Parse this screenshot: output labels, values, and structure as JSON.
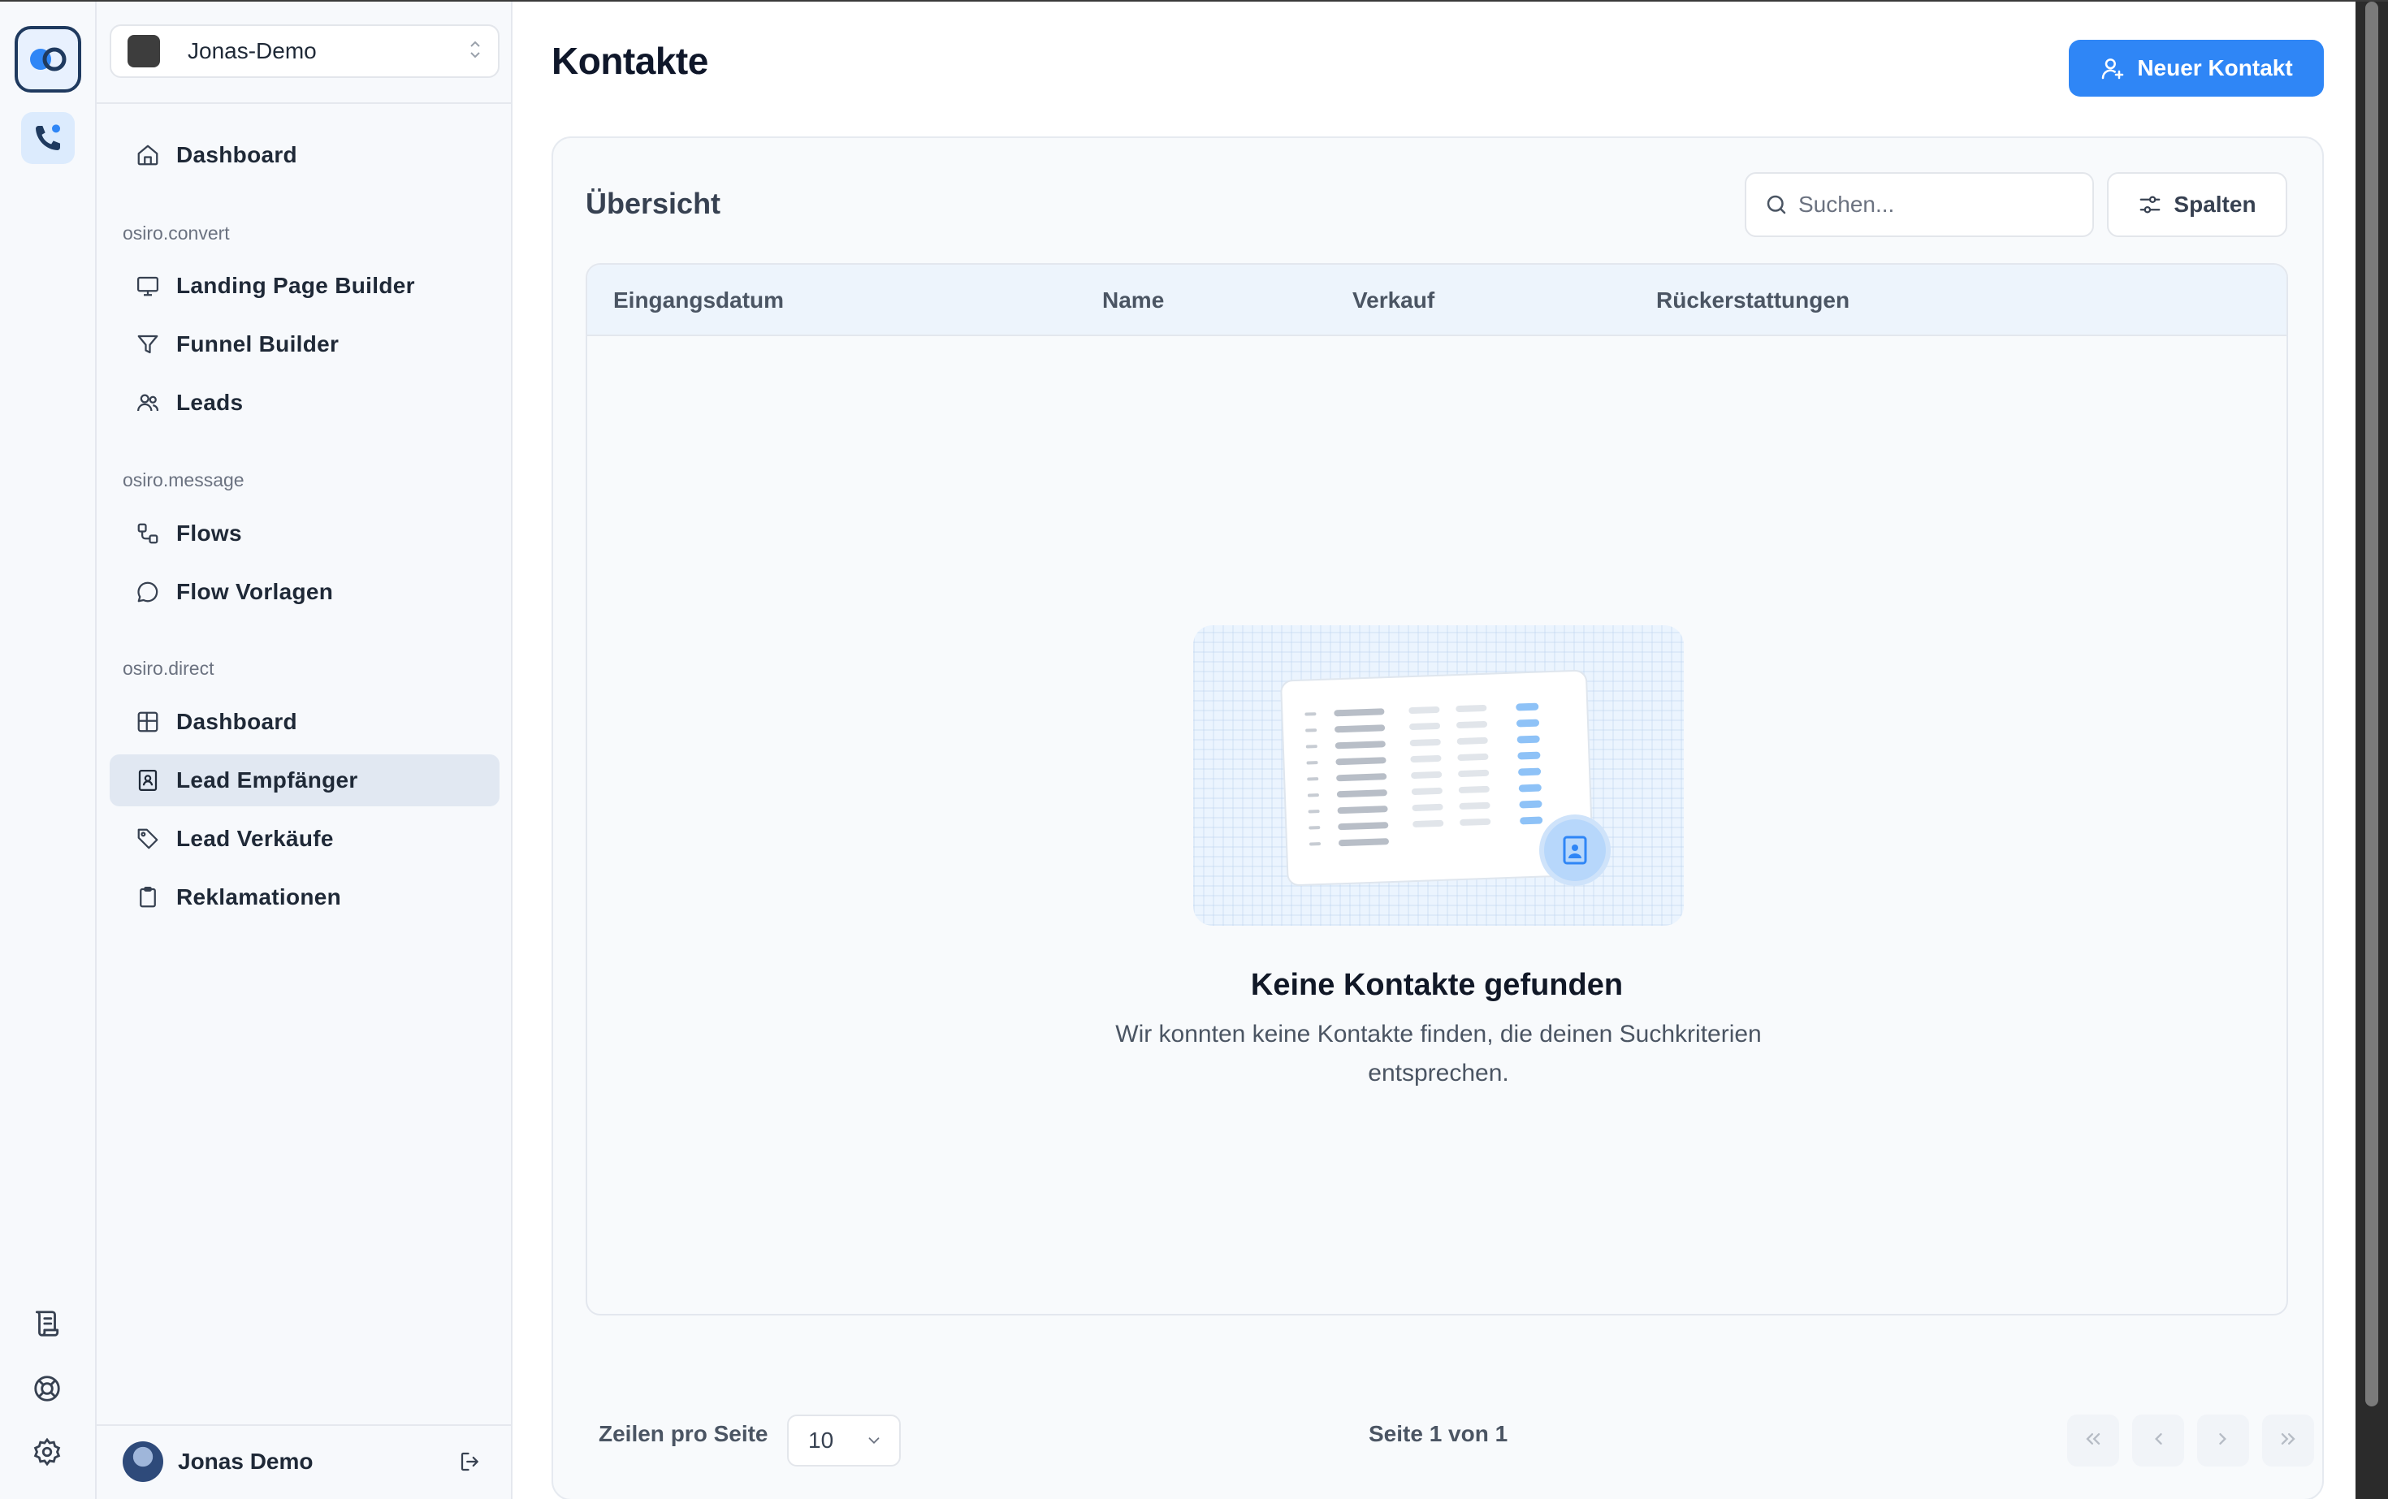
{
  "workspace": {
    "name": "Jonas-Demo"
  },
  "sidebar": {
    "top_item": {
      "label": "Dashboard",
      "icon": "home-icon"
    },
    "sections": [
      {
        "label": "osiro.convert",
        "items": [
          {
            "label": "Landing Page Builder",
            "icon": "monitor-icon"
          },
          {
            "label": "Funnel Builder",
            "icon": "filter-icon"
          },
          {
            "label": "Leads",
            "icon": "users-icon"
          }
        ]
      },
      {
        "label": "osiro.message",
        "items": [
          {
            "label": "Flows",
            "icon": "flow-icon"
          },
          {
            "label": "Flow Vorlagen",
            "icon": "chat-bubble-icon"
          }
        ]
      },
      {
        "label": "osiro.direct",
        "items": [
          {
            "label": "Dashboard",
            "icon": "grid-icon"
          },
          {
            "label": "Lead Empfänger",
            "icon": "contact-book-icon",
            "active": true
          },
          {
            "label": "Lead Verkäufe",
            "icon": "tag-icon"
          },
          {
            "label": "Reklamationen",
            "icon": "clipboard-icon"
          }
        ]
      }
    ],
    "user": {
      "name": "Jonas Demo"
    }
  },
  "main": {
    "title": "Kontakte",
    "new_contact_label": "Neuer Kontakt",
    "card": {
      "title": "Übersicht",
      "search_placeholder": "Suchen...",
      "columns_label": "Spalten",
      "table_headers": [
        "Eingangsdatum",
        "Name",
        "Verkauf",
        "Rückerstattungen"
      ],
      "rows": [],
      "empty_title": "Keine Kontakte gefunden",
      "empty_text": "Wir konnten keine Kontakte finden, die deinen Suchkriterien entsprechen."
    },
    "pagination": {
      "rows_label": "Zeilen pro Seite",
      "rows_value": "10",
      "page_info": "Seite 1 von 1"
    }
  },
  "colors": {
    "accent": "#2f86f6",
    "sidebar_bg": "#f7f9fc",
    "active_item_bg": "#e1e8f2",
    "table_header_bg": "#edf4fc"
  }
}
